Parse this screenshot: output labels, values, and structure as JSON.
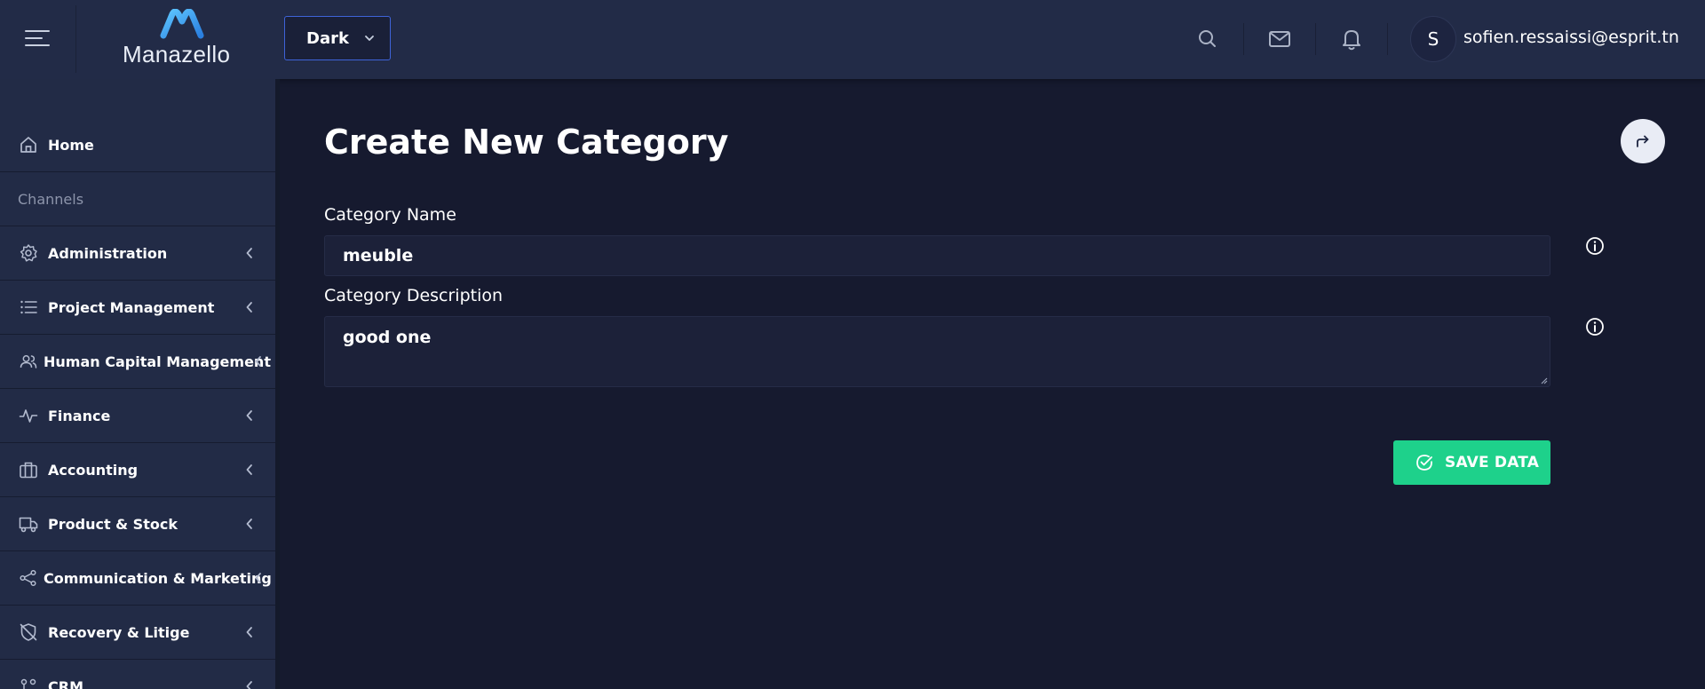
{
  "header": {
    "brand_name": "Manazello",
    "theme_select_value": "Dark",
    "user_initial": "S",
    "user_email": "sofien.ressaissi@esprit.tn"
  },
  "sidebar": {
    "items": [
      {
        "label": "Home",
        "icon": "home-icon",
        "type": "link"
      },
      {
        "label": "Channels",
        "type": "section"
      },
      {
        "label": "Administration",
        "icon": "gear-icon",
        "type": "group"
      },
      {
        "label": "Project Management",
        "icon": "list-icon",
        "type": "group"
      },
      {
        "label": "Human Capital Management",
        "icon": "users-icon",
        "type": "group"
      },
      {
        "label": "Finance",
        "icon": "activity-icon",
        "type": "group"
      },
      {
        "label": "Accounting",
        "icon": "briefcase-icon",
        "type": "group"
      },
      {
        "label": "Product & Stock",
        "icon": "truck-icon",
        "type": "group"
      },
      {
        "label": "Communication & Marketing",
        "icon": "share-icon",
        "type": "group"
      },
      {
        "label": "Recovery & Litige",
        "icon": "shield-off-icon",
        "type": "group"
      },
      {
        "label": "CRM",
        "icon": "crm-icon",
        "type": "group"
      }
    ]
  },
  "main": {
    "title": "Create New Category",
    "fields": {
      "name_label": "Category Name",
      "name_value": "meuble",
      "description_label": "Category Description",
      "description_value": "good one"
    },
    "save_label": "SAVE DATA"
  },
  "colors": {
    "background": "#161a2f",
    "header": "#222b47",
    "sidebar": "#222b46",
    "input": "#1c2139",
    "accent_green": "#1ed18b",
    "select_border": "#3e63d8"
  }
}
